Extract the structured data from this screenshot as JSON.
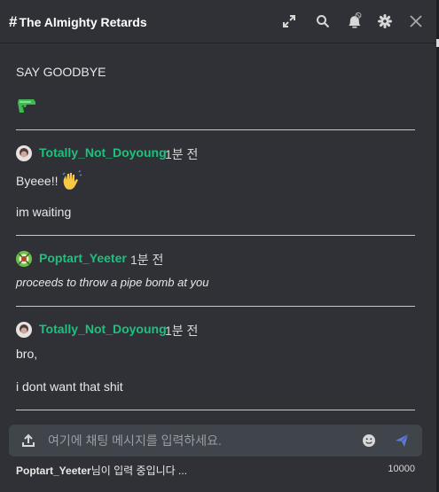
{
  "header": {
    "hash": "#",
    "channel_name": "The Almighty Retards",
    "icons": [
      "expand-icon",
      "search-icon",
      "bell-muted-icon",
      "gear-icon",
      "close-icon"
    ]
  },
  "messages": [
    {
      "type": "text",
      "text": "SAY GOODBYE"
    },
    {
      "type": "emoji",
      "icon": "water-pistol-emoji"
    },
    {
      "type": "divider"
    },
    {
      "type": "author",
      "author": "Totally_Not_Doyoung",
      "time": "1분 전",
      "avatar": "doyoung-avatar"
    },
    {
      "type": "text",
      "text": "Byeee!!",
      "icon": "waving-hand-emoji"
    },
    {
      "type": "text",
      "text": "im waiting"
    },
    {
      "type": "divider"
    },
    {
      "type": "author",
      "author": "Poptart_Yeeter",
      "time": "1분 전",
      "avatar": "yeeter-avatar"
    },
    {
      "type": "text",
      "text": "proceeds to throw a pipe bomb at you",
      "italic": true
    },
    {
      "type": "divider"
    },
    {
      "type": "author",
      "author": "Totally_Not_Doyoung",
      "time": "1분 전",
      "avatar": "doyoung-avatar"
    },
    {
      "type": "text",
      "text": "bro,"
    },
    {
      "type": "text",
      "text": "i dont want that shit"
    },
    {
      "type": "divider"
    }
  ],
  "composer": {
    "placeholder": "여기에 채팅 메시지를 입력하세요.",
    "value": ""
  },
  "typing": {
    "user": "Poptart_Yeeter",
    "suffix": "님이 입력 중입니다 ..."
  },
  "char_limit": "10000",
  "colors": {
    "background": "#2f3136",
    "author": "#1fc07e",
    "composer": "#40444b",
    "send": "#5b7bd5"
  }
}
